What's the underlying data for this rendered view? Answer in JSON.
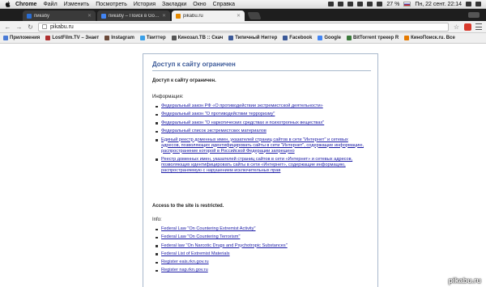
{
  "menubar": {
    "app": "Chrome",
    "items": [
      "Файл",
      "Изменить",
      "Посмотреть",
      "История",
      "Закладки",
      "Окно",
      "Справка"
    ],
    "battery": "27 %",
    "clock": "Пн, 22 сент.  22:14"
  },
  "tabs": [
    {
      "label": "пикабу",
      "favicon_color": "#2a6ed4",
      "active": false
    },
    {
      "label": "пикабу – Поиск в Google",
      "favicon_color": "#4285f4",
      "active": false
    },
    {
      "label": "pikabu.ru",
      "favicon_color": "#e58a00",
      "active": true
    }
  ],
  "toolbar": {
    "url": "pikabu.ru"
  },
  "bookmarks": [
    {
      "label": "Приложения",
      "color": "#4a7bd6"
    },
    {
      "label": "LostFilm.TV – Знает",
      "color": "#b03030"
    },
    {
      "label": "Instagram",
      "color": "#6b4a3a"
    },
    {
      "label": "Твиттер",
      "color": "#3aa0e8"
    },
    {
      "label": "Кинозал.ТВ :: Скач",
      "color": "#555555"
    },
    {
      "label": "Типичный Ниггер",
      "color": "#3b5998"
    },
    {
      "label": "Facebook",
      "color": "#3b5998"
    },
    {
      "label": "Google",
      "color": "#4285f4"
    },
    {
      "label": "BitTorrent трекер R",
      "color": "#3a7a3a"
    },
    {
      "label": "КиноПоиск.ru. Все",
      "color": "#e57a00"
    }
  ],
  "page": {
    "title": "Доступ к сайту ограничен",
    "lead": "Доступ к сайту ограничен.",
    "info_label": "Информация:",
    "ru_links": [
      "Федеральный закон РФ «О противодействии экстремистской деятельности»",
      "Федеральный закон \"О противодействии терроризму\"",
      "Федеральный закон \"О наркотических средствах и психотропных веществах\"",
      "Федеральный список экстремистских материалов",
      "Единый реестр доменных имен, указателей страниц сайтов в сети \"Интернет\" и сетевых адресов, позволяющих идентифицировать сайты в сети \"Интернет\", содержащие информацию, распространение которой в Российской Федерации запрещено",
      "Реестр доменных имен, указателей страниц сайтов в сети «Интернет» и сетевых адресов, позволяющих идентифицировать сайты в сети «Интернет», содержащие информацию, распространяемую с нарушением исключительных прав"
    ],
    "en_title": "Access to the site is restricted.",
    "en_info_label": "Info:",
    "en_links": [
      "Federal Law \"On Countering Extremist Activity\"",
      "Federal Law \"On Countering Terrorism\"",
      "Federal law \"On Narcotic Drugs and Psychotropic Substances\"",
      "Federal List of Extremist Materials",
      "Register eais.rkn.gov.ru",
      "Register nap.rkn.gov.ru"
    ]
  },
  "watermark": "pikabu.ru"
}
